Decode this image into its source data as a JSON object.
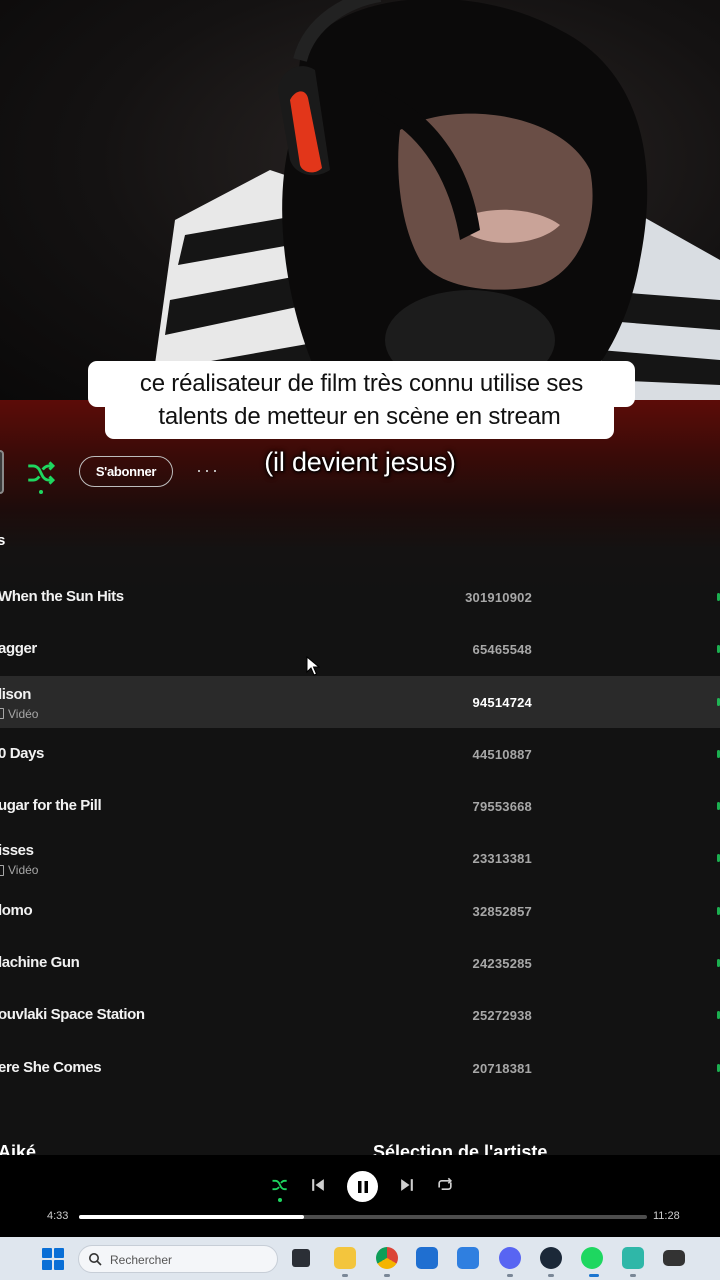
{
  "caption": {
    "line1": "ce réalisateur de film très connu utilise ses",
    "line2": "talents de metteur en scène en stream",
    "overlay": "(il devient jesus)"
  },
  "artist_header": {
    "subscribe_label": "S'abonner",
    "more_label": "···",
    "section_hint": "s"
  },
  "tracks": [
    {
      "title": "When the Sun Hits",
      "plays": "301910902"
    },
    {
      "title": "agger",
      "plays": "65465548"
    },
    {
      "title": "lison",
      "sub": "Vidéo",
      "plays": "94514724",
      "active": true
    },
    {
      "title": "0 Days",
      "plays": "44510887"
    },
    {
      "title": "ugar for the Pill",
      "plays": "79553668"
    },
    {
      "title": "isses",
      "sub": "Vidéo",
      "plays": "23313381"
    },
    {
      "title": "lomo",
      "plays": "32852857"
    },
    {
      "title": "lachine Gun",
      "plays": "24235285"
    },
    {
      "title": "ouvlaki Space Station",
      "plays": "25272938"
    },
    {
      "title": "ere She Comes",
      "plays": "20718381"
    }
  ],
  "cut_headings": {
    "left": "Aiké",
    "right": "Sélection de l'artiste"
  },
  "player": {
    "current_time": "4:33",
    "total_time": "11:28",
    "progress_fraction": 0.397
  },
  "taskbar": {
    "search_placeholder": "Rechercher",
    "apps": [
      "task-view-icon",
      "file-explorer-icon",
      "chrome-icon",
      "store-icon",
      "mail-icon",
      "discord-icon",
      "steam-icon",
      "spotify-icon",
      "app-icon",
      "media-icon"
    ]
  },
  "colors": {
    "accent_green": "#1ed760",
    "header_red": "#5c0c08",
    "background": "#121212"
  }
}
